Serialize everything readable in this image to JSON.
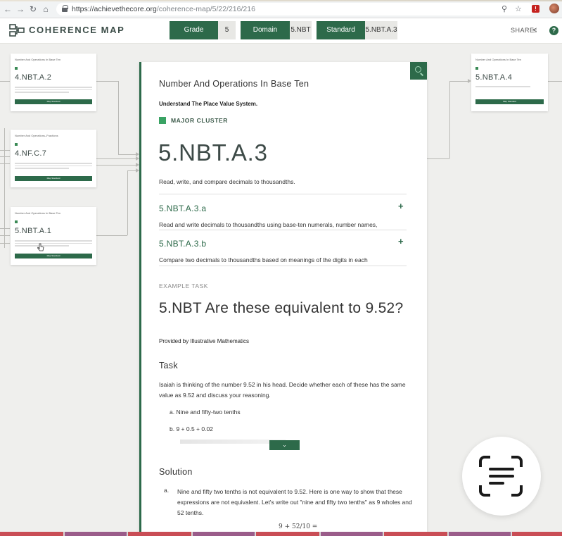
{
  "browser": {
    "url_host": "https://achievethecore.org",
    "url_path": "/coherence-map/5/22/216/216"
  },
  "header": {
    "app_title": "COHERENCE MAP",
    "grade_label": "Grade",
    "grade_value": "5",
    "domain_label": "Domain",
    "domain_value": "5.NBT",
    "standard_label": "Standard",
    "standard_value": "5.NBT.A.3",
    "share_label": "SHARE",
    "help_label": "?"
  },
  "map_cards": [
    {
      "code": "4.NBT.A.2",
      "title": "Number And Operations In Base Ten",
      "button": "Map Standard"
    },
    {
      "code": "4.NF.C.7",
      "title": "Number And Operations–Fractions",
      "button": "Map Standard"
    },
    {
      "code": "5.NBT.A.1",
      "title": "Number And Operations In Base Ten",
      "button": "Map Standard"
    },
    {
      "code": "5.NBT.A.4",
      "title": "Number And Operations In Base Ten",
      "button": "Map Standard"
    }
  ],
  "panel": {
    "cluster_title": "Number And Operations In Base Ten",
    "cluster_subtitle": "Understand The Place Value System.",
    "cluster_type": "MAJOR CLUSTER",
    "standard_code": "5.NBT.A.3",
    "standard_desc": "Read, write, and compare decimals to thousandths.",
    "substandards": [
      {
        "code": "5.NBT.A.3.a",
        "desc": "Read and write decimals to thousandths using base-ten numerals, number names,"
      },
      {
        "code": "5.NBT.A.3.b",
        "desc": "Compare two decimals to thousandths based on meanings of the digits in each"
      }
    ],
    "example_label": "EXAMPLE TASK",
    "task_title": "5.NBT Are these equivalent to 9.52?",
    "provider": "Provided by Illustrative Mathematics",
    "task_heading": "Task",
    "task_body": "Isaiah is thinking of the number 9.52 in his head. Decide whether each of these has the same value as 9.52 and discuss your reasoning.",
    "task_items": [
      "a. Nine and fifty-two tenths",
      "b. 9 + 0.5 + 0.02"
    ],
    "solution_heading": "Solution",
    "solution_marker": "a.",
    "solution_body": "Nine and fifty two tenths is not equivalent to 9.52. Here is one way to show that these expressions are not equivalent. Let's write out \"nine and fifty two tenths\" as 9 wholes and 52 tenths.",
    "math_preview": "9 + 52/10 ="
  },
  "colors": {
    "brand_green": "#2d6a4a",
    "major_green": "#3aa364"
  }
}
